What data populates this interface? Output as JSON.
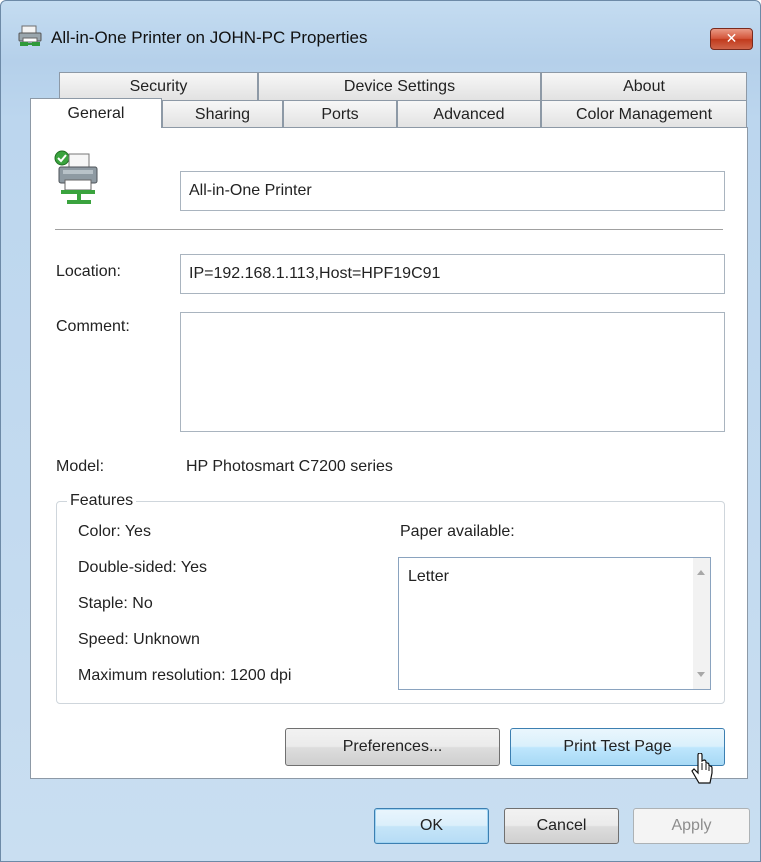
{
  "window": {
    "title": "All-in-One Printer on JOHN-PC Properties",
    "close_label": "✕"
  },
  "tabs": {
    "row1": [
      {
        "label": "Security"
      },
      {
        "label": "Device Settings"
      },
      {
        "label": "About"
      }
    ],
    "row2": [
      {
        "label": "General",
        "active": true
      },
      {
        "label": "Sharing"
      },
      {
        "label": "Ports"
      },
      {
        "label": "Advanced"
      },
      {
        "label": "Color Management"
      }
    ]
  },
  "general": {
    "printer_name": "All-in-One Printer",
    "location_label": "Location:",
    "location_value": "IP=192.168.1.113,Host=HPF19C91",
    "comment_label": "Comment:",
    "comment_value": "",
    "model_label": "Model:",
    "model_value": "HP Photosmart C7200 series",
    "features": {
      "legend": "Features",
      "color": "Color: Yes",
      "double_sided": "Double-sided: Yes",
      "staple": "Staple: No",
      "speed": "Speed: Unknown",
      "max_resolution": "Maximum resolution: 1200 dpi",
      "paper_label": "Paper available:",
      "paper_items": [
        "Letter"
      ]
    },
    "preferences_label": "Preferences...",
    "print_test_label": "Print Test Page"
  },
  "footer": {
    "ok_label": "OK",
    "cancel_label": "Cancel",
    "apply_label": "Apply"
  },
  "colors": {
    "window_frame": "#b5d0ea",
    "close_button": "#c13a1c",
    "hot_button": "#bee6fd"
  },
  "icons": {
    "title": "printer-network-icon",
    "printer": "printer-default-check-icon",
    "cursor": "mouse-pointer-icon"
  }
}
